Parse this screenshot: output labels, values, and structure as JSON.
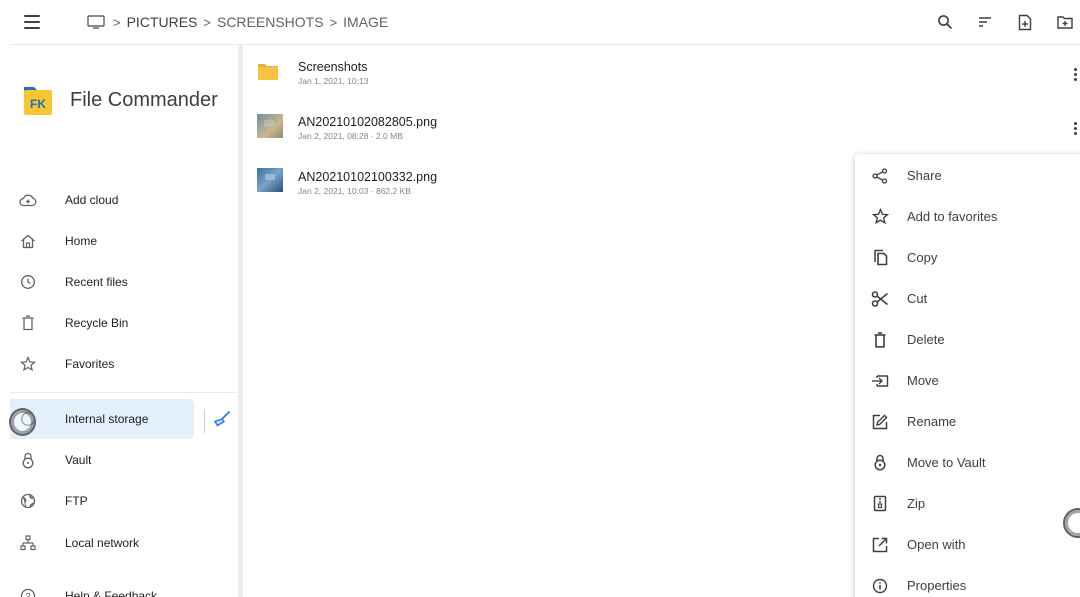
{
  "topbar": {
    "breadcrumb": [
      "PICTURES",
      "SCREENSHOTS",
      "IMAGE"
    ],
    "icons": [
      "menu-icon",
      "monitor-icon",
      "search-icon",
      "sort-icon",
      "new-file-icon",
      "new-folder-icon"
    ]
  },
  "sidebar": {
    "app_title": "File Commander",
    "logo_text": "FK",
    "items": [
      {
        "label": "Add cloud",
        "icon": "cloud-add-icon"
      },
      {
        "label": "Home",
        "icon": "home-icon"
      },
      {
        "label": "Recent files",
        "icon": "clock-icon"
      },
      {
        "label": "Recycle Bin",
        "icon": "trash-icon"
      },
      {
        "label": "Favorites",
        "icon": "star-icon"
      },
      {
        "label": "Internal storage",
        "icon": "storage-icon",
        "active": true
      },
      {
        "label": "Vault",
        "icon": "lock-icon"
      },
      {
        "label": "FTP",
        "icon": "globe-icon"
      },
      {
        "label": "Local network",
        "icon": "network-icon"
      },
      {
        "label": "Help & Feedback",
        "icon": "help-icon"
      }
    ]
  },
  "files": [
    {
      "name": "Screenshots",
      "meta": "Jan 1, 2021, 10:13",
      "type": "folder"
    },
    {
      "name": "AN20210102082805.png",
      "meta": "Jan 2, 2021, 08:28 · 2.0 MB",
      "type": "image"
    },
    {
      "name": "AN20210102100332.png",
      "meta": "Jan 2, 2021, 10:03 · 862.2 KB",
      "type": "image"
    }
  ],
  "context_menu": [
    {
      "label": "Share",
      "icon": "share-icon"
    },
    {
      "label": "Add to favorites",
      "icon": "star-icon"
    },
    {
      "label": "Copy",
      "icon": "copy-icon"
    },
    {
      "label": "Cut",
      "icon": "scissors-icon"
    },
    {
      "label": "Delete",
      "icon": "trash-icon"
    },
    {
      "label": "Move",
      "icon": "move-icon"
    },
    {
      "label": "Rename",
      "icon": "edit-icon"
    },
    {
      "label": "Move to Vault",
      "icon": "lock-icon"
    },
    {
      "label": "Zip",
      "icon": "zip-icon"
    },
    {
      "label": "Open with",
      "icon": "open-external-icon"
    },
    {
      "label": "Properties",
      "icon": "info-icon"
    }
  ],
  "colors": {
    "accent": "#1a73e8",
    "folder": "#f6c342",
    "logo_bg": "#f8c630",
    "logo_text": "#1e73be",
    "active_bg": "#e3f0fc",
    "icon": "#3c4043"
  }
}
